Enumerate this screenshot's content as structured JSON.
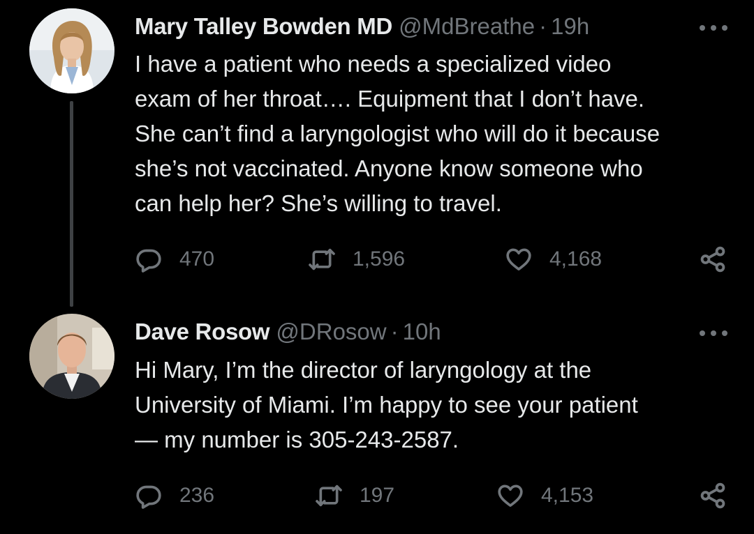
{
  "tweets": [
    {
      "author": {
        "name": "Mary Talley Bowden MD",
        "handle": "@MdBreathe",
        "time": "19h"
      },
      "text": "I have a patient who needs a specialized video\nexam of her throat…. Equipment that I don’t have.\nShe can’t find a laryngologist who will do it because\nshe’s not vaccinated.  Anyone know someone who\ncan help her?  She’s willing to travel.",
      "stats": {
        "replies": "470",
        "retweets": "1,596",
        "likes": "4,168"
      }
    },
    {
      "author": {
        "name": "Dave Rosow",
        "handle": "@DRosow",
        "time": "10h"
      },
      "text": "Hi Mary, I’m the director of laryngology at the\nUniversity of Miami. I’m happy to see your patient\n— my number is 305-243-2587.",
      "stats": {
        "replies": "236",
        "retweets": "197",
        "likes": "4,153"
      }
    }
  ],
  "theme": {
    "background": "#000000",
    "text_primary": "#e7e9ea",
    "text_secondary": "#71767b",
    "thread_line": "#3e4144"
  },
  "icons": {
    "reply": "reply-icon",
    "retweet": "retweet-icon",
    "like": "heart-icon",
    "share": "share-icon",
    "more": "more-icon"
  }
}
